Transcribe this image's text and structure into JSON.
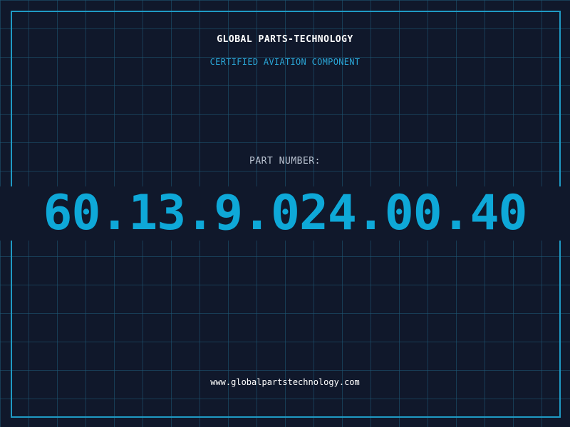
{
  "header": {
    "company_name": "GLOBAL PARTS-TECHNOLOGY",
    "certification": "CERTIFIED AVIATION COMPONENT"
  },
  "part": {
    "label": "PART NUMBER:",
    "number": "60.13.9.024.00.40"
  },
  "footer": {
    "website": "www.globalpartstechnology.com"
  },
  "colors": {
    "background": "#10182b",
    "grid": "#1e5a78",
    "frame": "#1f9ac4",
    "accent": "#0ea8d8"
  }
}
